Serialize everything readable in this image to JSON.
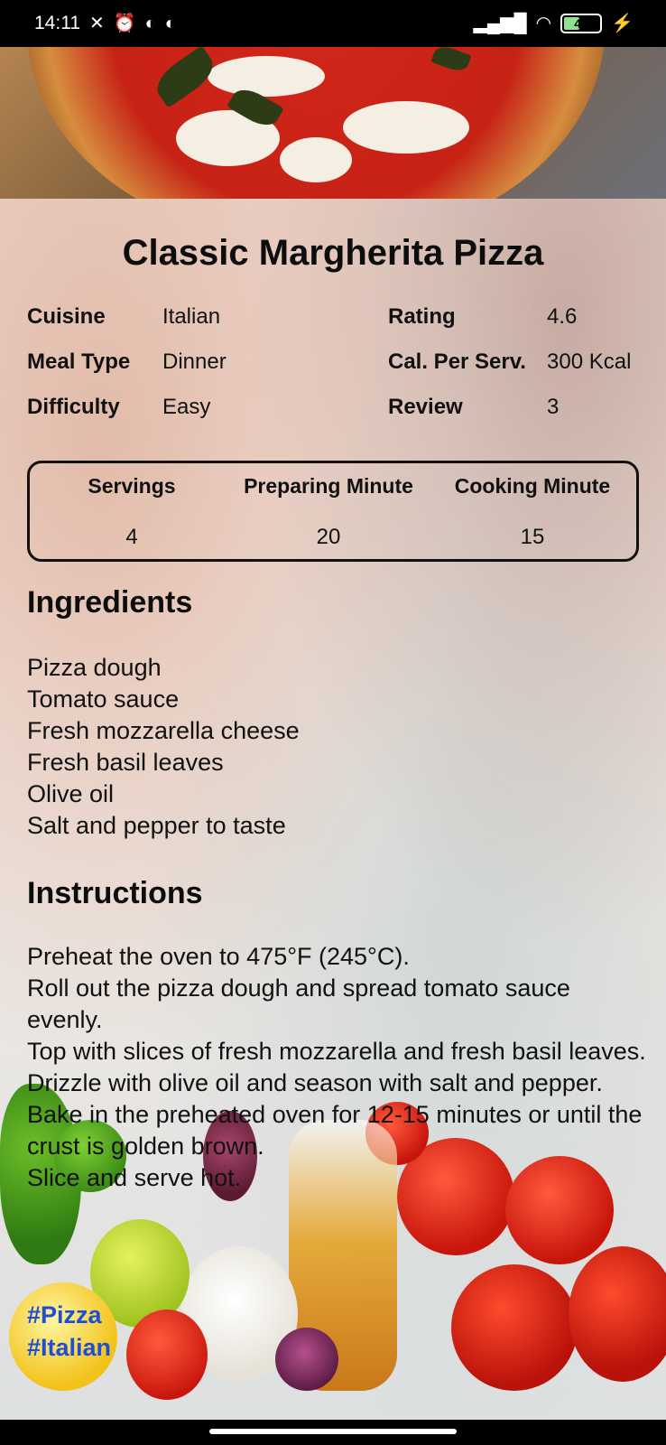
{
  "status_bar": {
    "time": "14:11",
    "icons": [
      "mute-icon",
      "alarm-icon",
      "app-icon",
      "app-icon"
    ],
    "battery_level": "40"
  },
  "recipe": {
    "title": "Classic Margherita Pizza",
    "info": {
      "cuisine_label": "Cuisine",
      "cuisine_value": "Italian",
      "meal_type_label": "Meal Type",
      "meal_type_value": "Dinner",
      "difficulty_label": "Difficulty",
      "difficulty_value": "Easy",
      "rating_label": "Rating",
      "rating_value": "4.6",
      "calories_label": "Cal. Per Serv.",
      "calories_value": "300 Kcal",
      "review_label": "Review",
      "review_value": "3"
    },
    "stats": [
      {
        "label": "Servings",
        "value": "4"
      },
      {
        "label": "Preparing Minute",
        "value": "20"
      },
      {
        "label": "Cooking Minute",
        "value": "15"
      }
    ],
    "ingredients_title": "Ingredients",
    "ingredients": [
      "Pizza dough",
      "Tomato sauce",
      "Fresh mozzarella cheese",
      "Fresh basil leaves",
      "Olive oil",
      "Salt and pepper to taste"
    ],
    "instructions_title": "Instructions",
    "instructions": [
      "Preheat the oven to 475°F (245°C).",
      "Roll out the pizza dough and spread tomato sauce evenly.",
      "Top with slices of fresh mozzarella and fresh basil leaves.",
      "Drizzle with olive oil and season with salt and pepper.",
      "Bake in the preheated oven for 12-15 minutes or until the crust is golden brown.",
      "Slice and serve hot."
    ],
    "tags": [
      "#Pizza",
      "#Italian"
    ]
  }
}
